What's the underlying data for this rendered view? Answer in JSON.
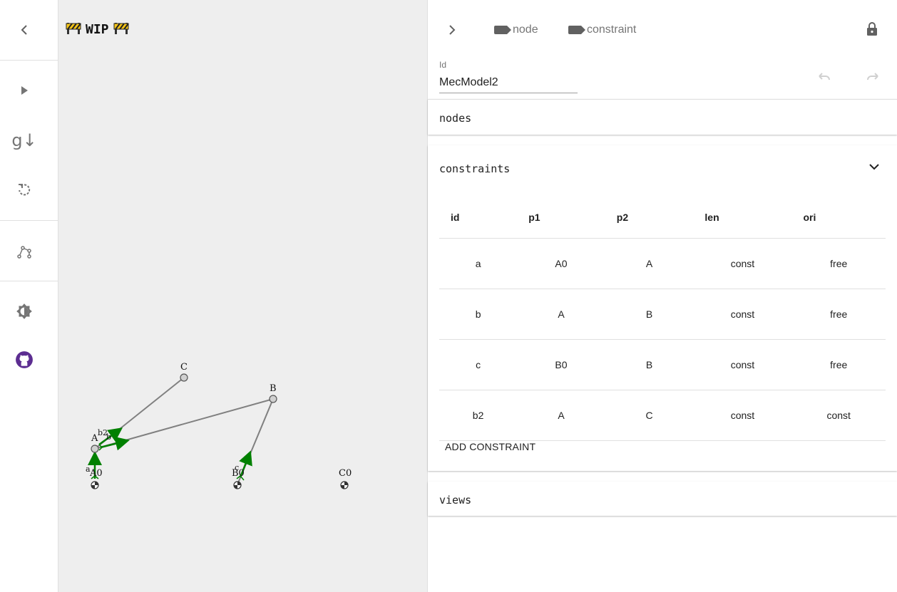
{
  "toolbar": {
    "items": [
      {
        "name": "collapse-button",
        "icon": "chevron-left-icon"
      },
      {
        "name": "run-button",
        "icon": "play-icon"
      },
      {
        "name": "gravity-button",
        "icon": "gravity-icon",
        "label": "g↓"
      },
      {
        "name": "reset-button",
        "icon": "rotate-icon"
      },
      {
        "name": "linkage-button",
        "icon": "linkage-icon"
      },
      {
        "name": "theme-button",
        "icon": "brightness-icon"
      },
      {
        "name": "github-link",
        "icon": "github-icon"
      }
    ],
    "gravity_label": "g↓",
    "github_color": "#5c2d91"
  },
  "canvas": {
    "banner_text": "WIP",
    "banner_icon": "construction-icon",
    "background": "#eeeeee",
    "nodes": [
      {
        "id": "A0",
        "label": "A0",
        "base": true
      },
      {
        "id": "A",
        "label": "A",
        "base": false
      },
      {
        "id": "B",
        "label": "B",
        "base": false
      },
      {
        "id": "B0",
        "label": "B0",
        "base": true
      },
      {
        "id": "C",
        "label": "C",
        "base": false
      },
      {
        "id": "C0",
        "label": "C0",
        "base": true
      }
    ],
    "constraint_labels": [
      "a",
      "b",
      "b2",
      "c"
    ],
    "link_color": "#808080",
    "vector_color": "#008000"
  },
  "panel": {
    "chips": [
      {
        "label": "node",
        "icon": "tag-icon"
      },
      {
        "label": "constraint",
        "icon": "tag-icon"
      }
    ],
    "lock_icon": "lock-icon",
    "id_label": "Id",
    "id_value": "MecModel2",
    "sections": {
      "nodes_title": "nodes",
      "constraints_title": "constraints",
      "views_title": "views"
    },
    "constraints_table": {
      "columns": [
        "id",
        "p1",
        "p2",
        "len",
        "ori"
      ],
      "rows": [
        [
          "a",
          "A0",
          "A",
          "const",
          "free"
        ],
        [
          "b",
          "A",
          "B",
          "const",
          "free"
        ],
        [
          "c",
          "B0",
          "B",
          "const",
          "free"
        ],
        [
          "b2",
          "A",
          "C",
          "const",
          "const"
        ]
      ]
    },
    "add_constraint_label": "ADD CONSTRAINT"
  }
}
